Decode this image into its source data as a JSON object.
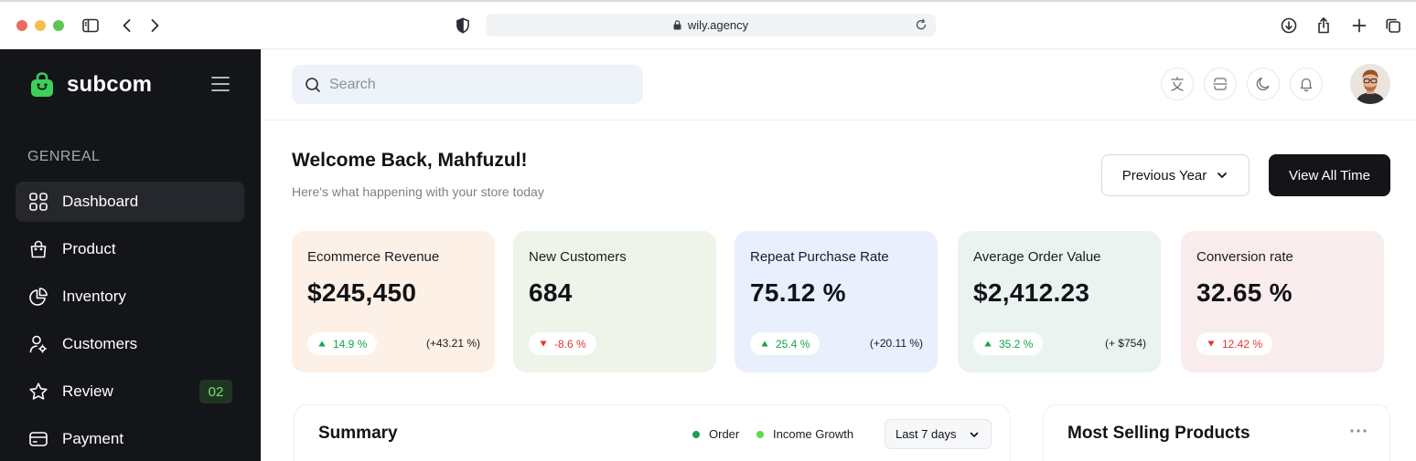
{
  "browser": {
    "url": "wily.agency"
  },
  "sidebar": {
    "brand": "subcom",
    "section_title": "GENREAL",
    "items": [
      {
        "label": "Dashboard",
        "icon": "dashboard-grid-icon",
        "active": true
      },
      {
        "label": "Product",
        "icon": "shopping-bag-icon"
      },
      {
        "label": "Inventory",
        "icon": "pie-chart-icon"
      },
      {
        "label": "Customers",
        "icon": "user-group-icon"
      },
      {
        "label": "Review",
        "icon": "star-icon",
        "badge": "02"
      },
      {
        "label": "Payment",
        "icon": "credit-card-icon"
      }
    ]
  },
  "topbar": {
    "search_placeholder": "Search",
    "icons": [
      "translate-icon",
      "scan-icon",
      "moon-icon",
      "bell-icon"
    ]
  },
  "welcome": {
    "title": "Welcome Back, Mahfuzul!",
    "subtitle": "Here's what happening with your store today",
    "period_button": "Previous Year",
    "view_all_button": "View All Time"
  },
  "stats": [
    {
      "label": "Ecommerce Revenue",
      "value": "$245,450",
      "change": "14.9 %",
      "direction": "up",
      "extra": "(+43.21 %)",
      "bg": "#fdf0e6"
    },
    {
      "label": "New Customers",
      "value": "684",
      "change": "-8.6 %",
      "direction": "down",
      "extra": "",
      "bg": "#eef4ea"
    },
    {
      "label": "Repeat Purchase Rate",
      "value": "75.12 %",
      "change": "25.4 %",
      "direction": "up",
      "extra": "(+20.11 %)",
      "bg": "#e9effd"
    },
    {
      "label": "Average Order Value",
      "value": "$2,412.23",
      "change": "35.2 %",
      "direction": "up",
      "extra": "(+ $754)",
      "bg": "#ebf3f0"
    },
    {
      "label": "Conversion rate",
      "value": "32.65 %",
      "change": "12.42 %",
      "direction": "down",
      "extra": "",
      "bg": "#f8ecec"
    }
  ],
  "summary": {
    "title": "Summary",
    "legend": [
      {
        "label": "Order",
        "color": "#1f9b5c"
      },
      {
        "label": "Income Growth",
        "color": "#62d84e"
      }
    ],
    "range": "Last 7 days"
  },
  "most_selling": {
    "title": "Most Selling Products"
  },
  "colors": {
    "sidebar_bg": "#141519",
    "accent_green": "#3ccf5a",
    "up": "#12a34f",
    "down": "#e5352f"
  }
}
